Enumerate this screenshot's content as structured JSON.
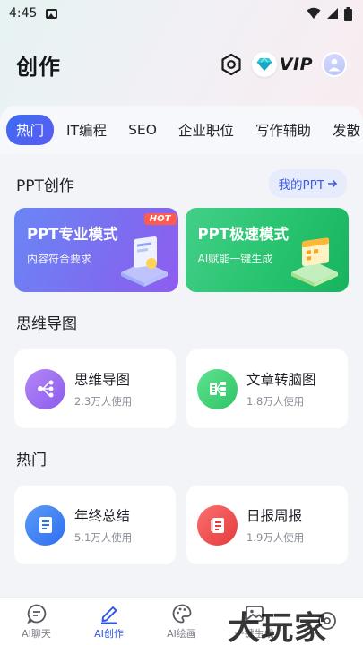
{
  "status_bar": {
    "time": "4:45"
  },
  "header": {
    "title": "创作",
    "vip_label": "VIP"
  },
  "tabs": [
    {
      "label": "热门",
      "active": true
    },
    {
      "label": "IT编程"
    },
    {
      "label": "SEO"
    },
    {
      "label": "企业职位"
    },
    {
      "label": "写作辅助"
    },
    {
      "label": "发散"
    }
  ],
  "ppt_section": {
    "title": "PPT创作",
    "my_ppt_label": "我的PPT",
    "cards": [
      {
        "name": "PPT专业模式",
        "desc": "内容符合要求",
        "tag": "HOT"
      },
      {
        "name": "PPT极速模式",
        "desc": "AI赋能一键生成"
      }
    ]
  },
  "mindmap_section": {
    "title": "思维导图",
    "items": [
      {
        "name": "思维导图",
        "count": "2.3万人使用",
        "icon": "mindmap-icon",
        "color": "#9a6cf1"
      },
      {
        "name": "文章转脑图",
        "count": "1.8万人使用",
        "icon": "article-icon",
        "color": "#3fcf78"
      }
    ]
  },
  "hot_section": {
    "title": "热门",
    "items": [
      {
        "name": "年终总结",
        "count": "5.1万人使用",
        "icon": "document-icon",
        "color": "#3f83f2"
      },
      {
        "name": "日报周报",
        "count": "1.9万人使用",
        "icon": "report-icon",
        "color": "#ef4a4a"
      }
    ]
  },
  "bottom_nav": [
    {
      "label": "AI聊天",
      "icon": "chat-icon"
    },
    {
      "label": "AI创作",
      "icon": "pen-icon",
      "active": true
    },
    {
      "label": "AI绘画",
      "icon": "palette-icon"
    },
    {
      "label": "一键生成",
      "icon": "image-icon"
    },
    {
      "label": "",
      "icon": "more-icon"
    }
  ],
  "watermark": "大玩家",
  "colors": {
    "accent": "#3d6cf0",
    "pro_card": "#7b6ef0",
    "fast_card": "#27c36f",
    "hot_tag": "#ff5a4e"
  }
}
